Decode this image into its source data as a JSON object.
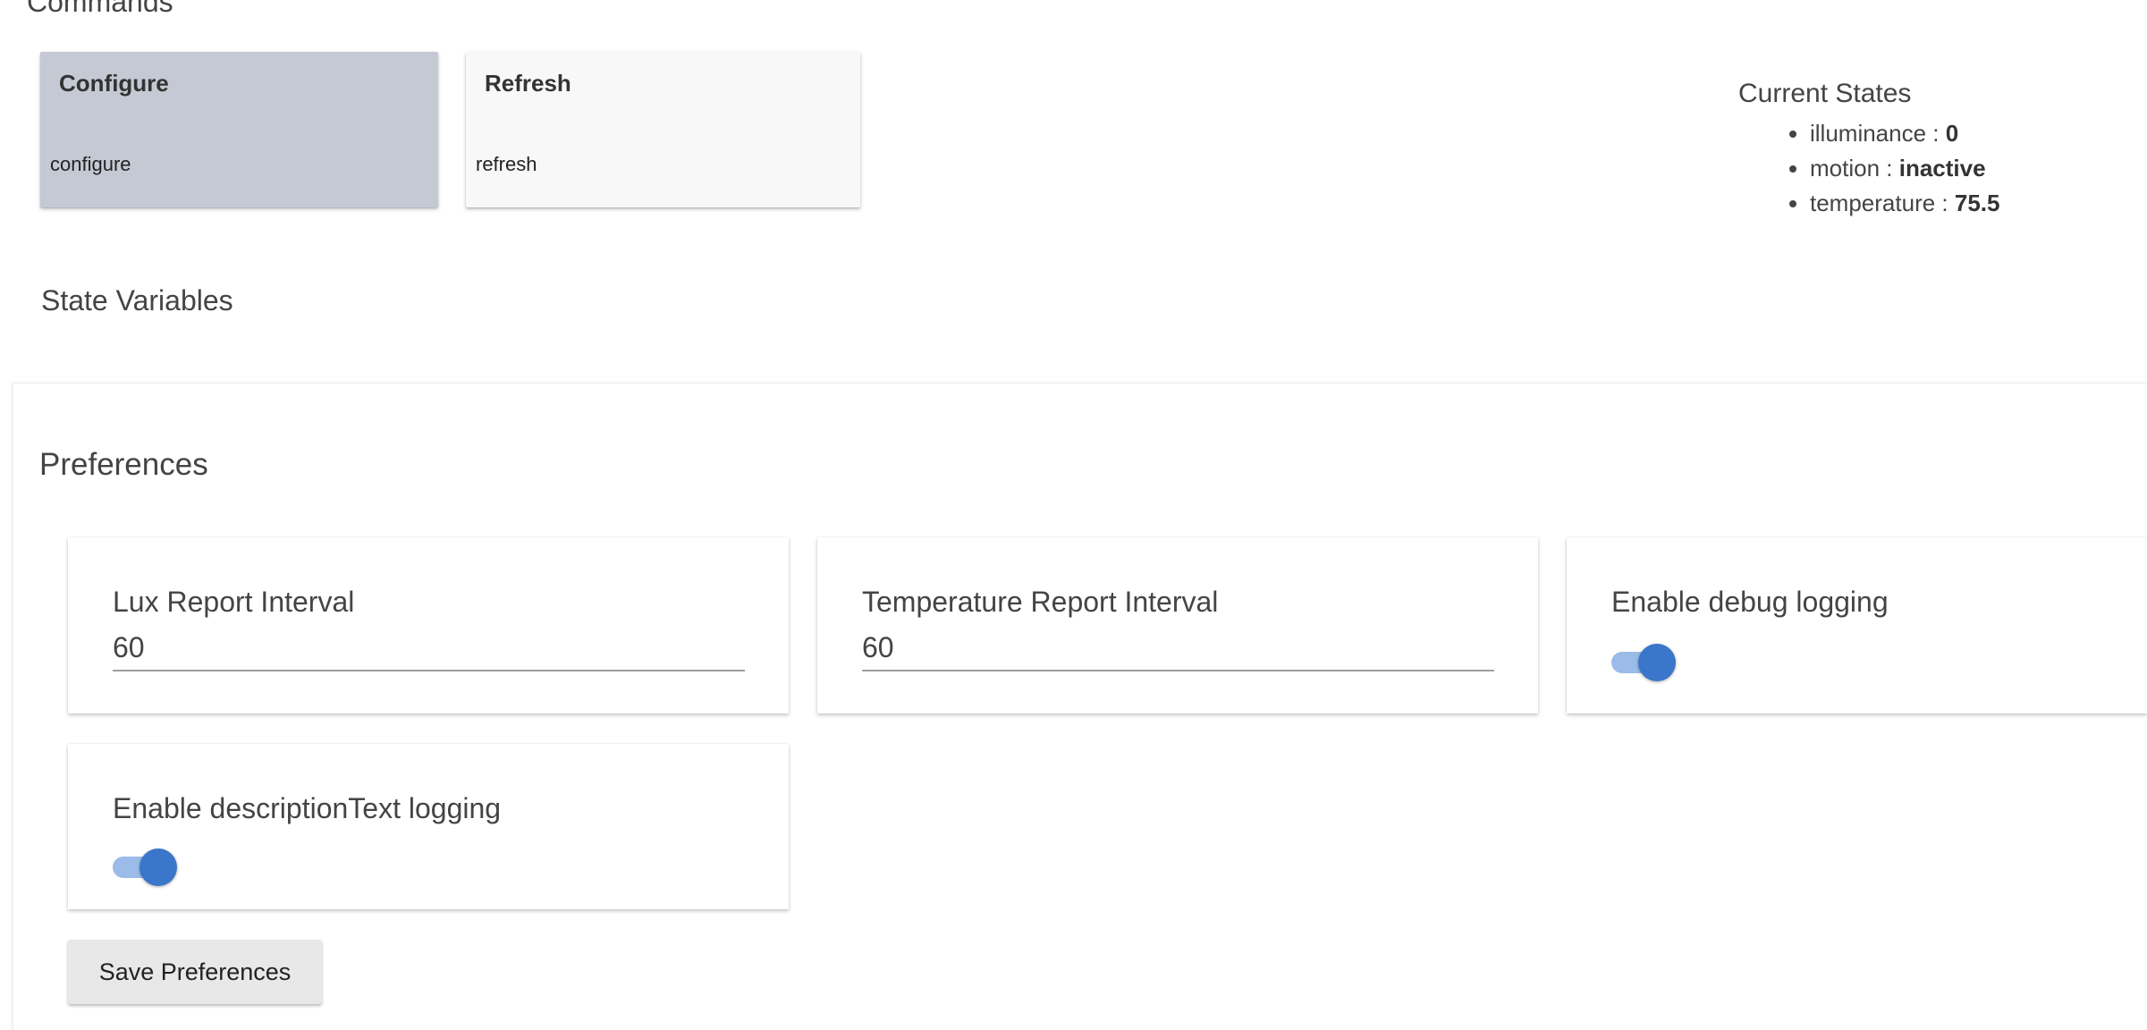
{
  "commands": {
    "section_title": "Commands",
    "items": [
      {
        "title": "Configure",
        "name": "configure"
      },
      {
        "title": "Refresh",
        "name": "refresh"
      }
    ]
  },
  "current_states": {
    "title": "Current States",
    "items": [
      {
        "key": "illuminance",
        "sep": " : ",
        "value": "0"
      },
      {
        "key": "motion",
        "sep": " : ",
        "value": "inactive"
      },
      {
        "key": "temperature",
        "sep": " : ",
        "value": "75.5"
      }
    ]
  },
  "state_variables": {
    "title": "State Variables"
  },
  "preferences": {
    "title": "Preferences",
    "lux_report_interval": {
      "label": "Lux Report Interval",
      "value": "60"
    },
    "temperature_report_interval": {
      "label": "Temperature Report Interval",
      "value": "60"
    },
    "enable_debug_logging": {
      "label": "Enable debug logging",
      "checked": true
    },
    "enable_description_text_logging": {
      "label": "Enable descriptionText logging",
      "checked": true
    },
    "save_label": "Save Preferences"
  },
  "colors": {
    "accent": "#3a76c9",
    "toggle_track": "#9bbce8",
    "configure_card_bg": "#c4c9d4",
    "refresh_card_bg": "#f8f8f8"
  }
}
